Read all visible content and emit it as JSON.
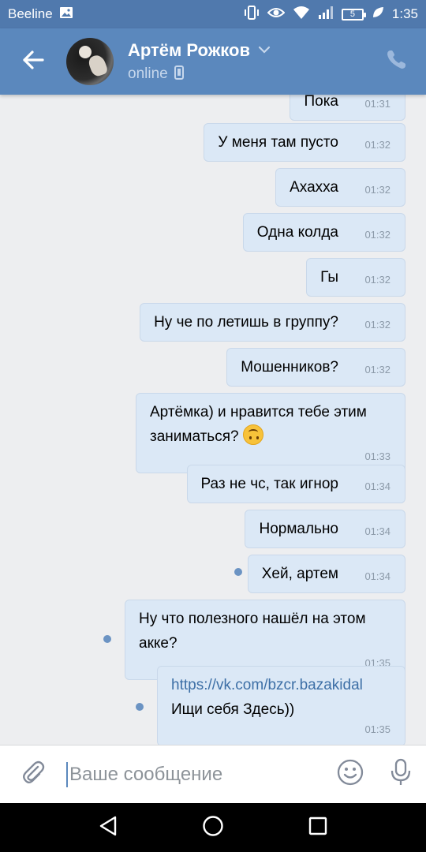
{
  "status_bar": {
    "carrier": "Beeline",
    "battery": "5",
    "time": "1:35",
    "icons": [
      "image-icon",
      "vibrate-icon",
      "eye-icon",
      "wifi-icon",
      "signal-icon",
      "battery-icon",
      "leaf-icon"
    ]
  },
  "header": {
    "name": "Артём Рожков",
    "status": "online",
    "back_icon": "arrow-left-icon",
    "call_icon": "phone-icon",
    "colors": {
      "bar": "#5b88bd",
      "status_bar": "#5079ad"
    }
  },
  "messages": [
    {
      "text": "Пока",
      "time": "01:31"
    },
    {
      "text": "У меня там пусто",
      "time": "01:32"
    },
    {
      "text": "Ахахха",
      "time": "01:32"
    },
    {
      "text": "Одна колда",
      "time": "01:32"
    },
    {
      "text": "Гы",
      "time": "01:32"
    },
    {
      "text": "Ну че по летишь в группу?",
      "time": "01:32"
    },
    {
      "text": "Мошенников?",
      "time": "01:32"
    },
    {
      "text": "Артёмка) и нравится тебе этим\nзаниматься?",
      "time": "01:33",
      "emoji": "upside-down-face-icon"
    },
    {
      "text": "Раз не чс, так игнор",
      "time": "01:34"
    },
    {
      "text": "Нормально",
      "time": "01:34"
    },
    {
      "text": "Хей, артем",
      "time": "01:34",
      "unread": true
    },
    {
      "text": "Ну что полезного нашёл на этом\nакке?",
      "time": "01:35",
      "unread": true
    },
    {
      "link": "https://vk.com/bzcr.bazakidal",
      "text": "Ищи себя Здесь))",
      "time": "01:35",
      "unread": true
    }
  ],
  "composer": {
    "placeholder": "Ваше сообщение",
    "attach_icon": "paperclip-icon",
    "emoji_icon": "smile-icon",
    "mic_icon": "microphone-icon"
  },
  "nav_bar": {
    "icons": [
      "back-triangle-icon",
      "home-circle-icon",
      "recents-square-icon"
    ]
  }
}
